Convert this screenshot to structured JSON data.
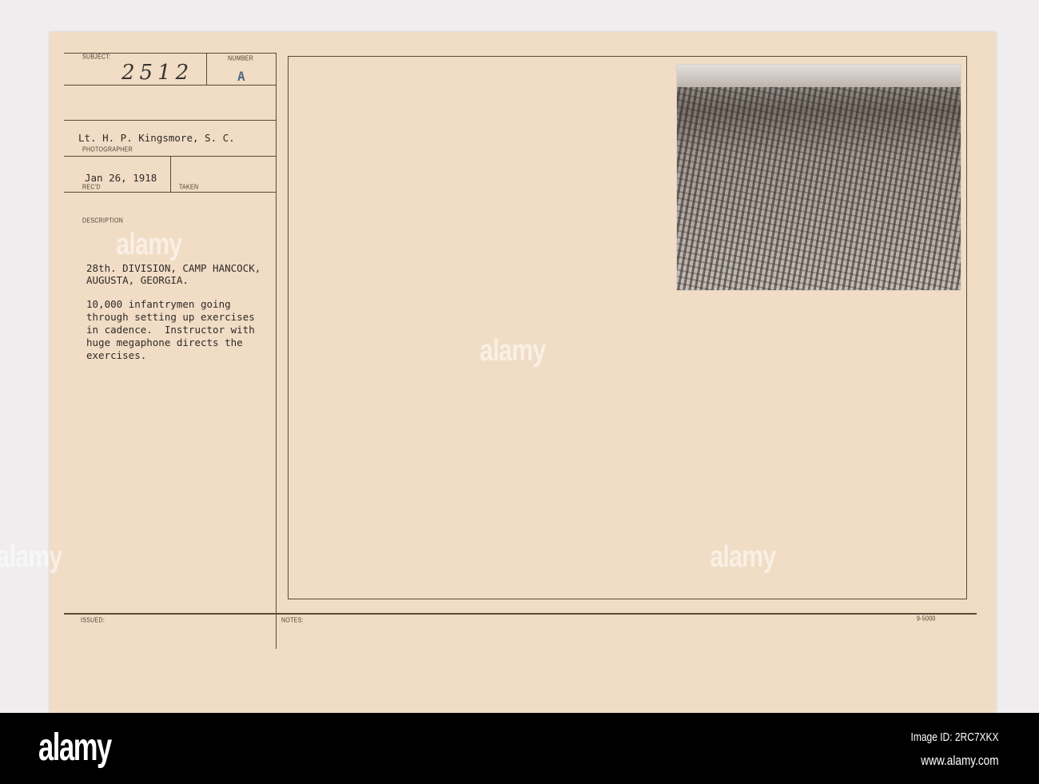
{
  "card": {
    "subject_label": "SUBJECT:",
    "subject_value": "2512",
    "number_label": "NUMBER",
    "number_value": "A",
    "photographer": "Lt. H. P. Kingsmore, S. C.",
    "photographer_label": "PHOTOGRAPHER",
    "received_date": "Jan 26, 1918",
    "received_label": "REC'D",
    "taken_label": "TAKEN",
    "description_label": "DESCRIPTION",
    "description_lines": [
      "28th. DIVISION, CAMP HANCOCK,",
      "AUGUSTA, GEORGIA.",
      "",
      "10,000 infantrymen going",
      "through setting up exercises",
      "in cadence.  Instructor with",
      "huge megaphone directs the",
      "exercises."
    ],
    "issued_label": "ISSUED:",
    "notes_label": "NOTES:",
    "form_code": "9-5000"
  },
  "watermark": "alamy",
  "footer": {
    "logo": "alamy",
    "image_id": "Image ID: 2RC7XKX",
    "url": "www.alamy.com"
  }
}
